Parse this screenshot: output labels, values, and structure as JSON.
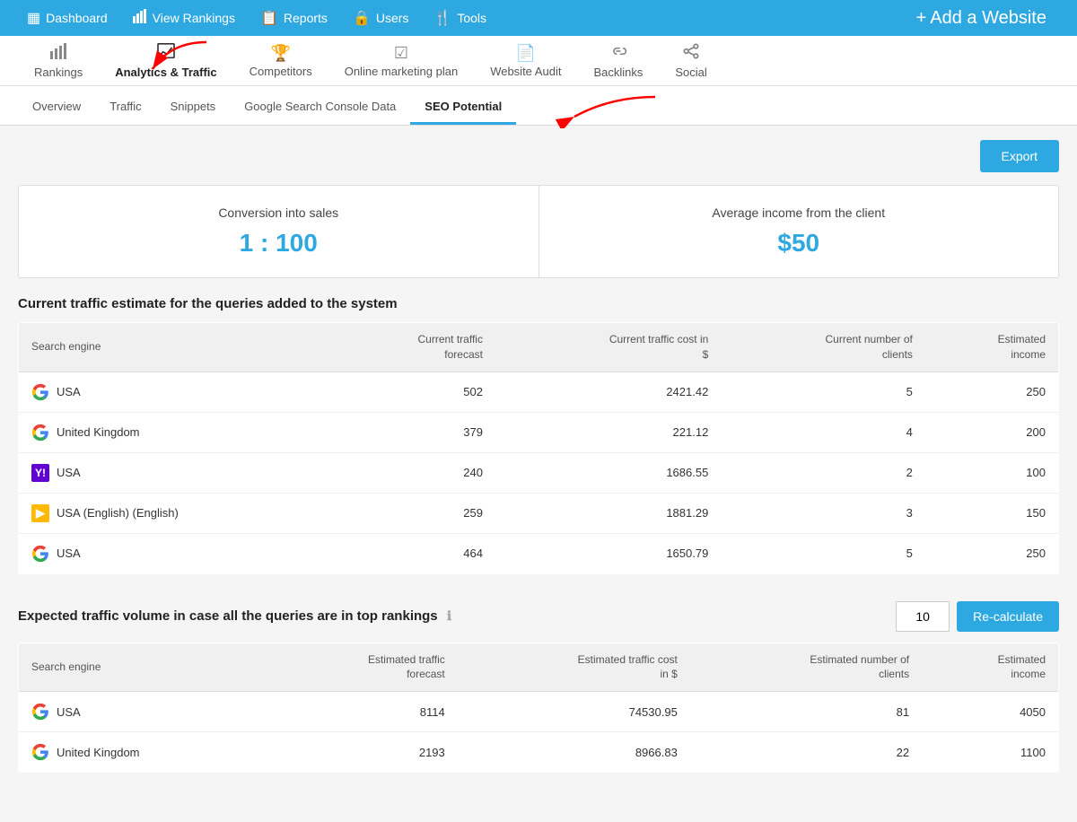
{
  "topNav": {
    "items": [
      {
        "id": "dashboard",
        "label": "Dashboard",
        "icon": "▦"
      },
      {
        "id": "view-rankings",
        "label": "View Rankings",
        "icon": "📊"
      },
      {
        "id": "reports",
        "label": "Reports",
        "icon": "📋"
      },
      {
        "id": "users",
        "label": "Users",
        "icon": "🔒"
      },
      {
        "id": "tools",
        "label": "Tools",
        "icon": "🍴"
      }
    ],
    "addWebsite": "Add a Website"
  },
  "secondNav": {
    "items": [
      {
        "id": "rankings",
        "label": "Rankings",
        "icon": "bar"
      },
      {
        "id": "analytics-traffic",
        "label": "Analytics & Traffic",
        "icon": "chart",
        "active": true
      },
      {
        "id": "competitors",
        "label": "Competitors",
        "icon": "trophy"
      },
      {
        "id": "online-marketing-plan",
        "label": "Online marketing plan",
        "icon": "check"
      },
      {
        "id": "website-audit",
        "label": "Website Audit",
        "icon": "doc"
      },
      {
        "id": "backlinks",
        "label": "Backlinks",
        "icon": "link"
      },
      {
        "id": "social",
        "label": "Social",
        "icon": "share"
      }
    ]
  },
  "tabNav": {
    "items": [
      {
        "id": "overview",
        "label": "Overview"
      },
      {
        "id": "traffic",
        "label": "Traffic"
      },
      {
        "id": "snippets",
        "label": "Snippets"
      },
      {
        "id": "google-search-console",
        "label": "Google Search Console Data"
      },
      {
        "id": "seo-potential",
        "label": "SEO Potential",
        "active": true
      }
    ]
  },
  "exportButton": "Export",
  "stats": {
    "conversion": {
      "label": "Conversion into sales",
      "value": "1 : 100"
    },
    "income": {
      "label": "Average income from the client",
      "value": "$50"
    }
  },
  "currentTraffic": {
    "title": "Current traffic estimate for the queries added to the system",
    "columns": [
      {
        "id": "engine",
        "label": "Search engine"
      },
      {
        "id": "forecast",
        "label": "Current traffic\nforecast"
      },
      {
        "id": "cost",
        "label": "Current traffic cost in\n$"
      },
      {
        "id": "clients",
        "label": "Current number of\nclients"
      },
      {
        "id": "income",
        "label": "Estimated\nincome"
      }
    ],
    "rows": [
      {
        "engine": "USA",
        "engineType": "google",
        "forecast": "502",
        "cost": "2421.42",
        "clients": "5",
        "income": "250"
      },
      {
        "engine": "United Kingdom",
        "engineType": "google",
        "forecast": "379",
        "cost": "221.12",
        "clients": "4",
        "income": "200"
      },
      {
        "engine": "USA",
        "engineType": "yahoo",
        "forecast": "240",
        "cost": "1686.55",
        "clients": "2",
        "income": "100"
      },
      {
        "engine": "USA (English) (English)",
        "engineType": "bing",
        "forecast": "259",
        "cost": "1881.29",
        "clients": "3",
        "income": "150"
      },
      {
        "engine": "USA",
        "engineType": "google2",
        "forecast": "464",
        "cost": "1650.79",
        "clients": "5",
        "income": "250"
      }
    ]
  },
  "expectedTraffic": {
    "title": "Expected traffic volume in case all the queries are in top rankings",
    "topValue": "10",
    "recalcButton": "Re-calculate",
    "columns": [
      {
        "id": "engine",
        "label": "Search engine"
      },
      {
        "id": "forecast",
        "label": "Estimated traffic\nforecast"
      },
      {
        "id": "cost",
        "label": "Estimated traffic cost\nin $"
      },
      {
        "id": "clients",
        "label": "Estimated number of\nclients"
      },
      {
        "id": "income",
        "label": "Estimated\nincome"
      }
    ],
    "rows": [
      {
        "engine": "USA",
        "engineType": "google",
        "forecast": "8114",
        "cost": "74530.95",
        "clients": "81",
        "income": "4050"
      },
      {
        "engine": "United Kingdom",
        "engineType": "google",
        "forecast": "2193",
        "cost": "8966.83",
        "clients": "22",
        "income": "1100"
      }
    ]
  }
}
